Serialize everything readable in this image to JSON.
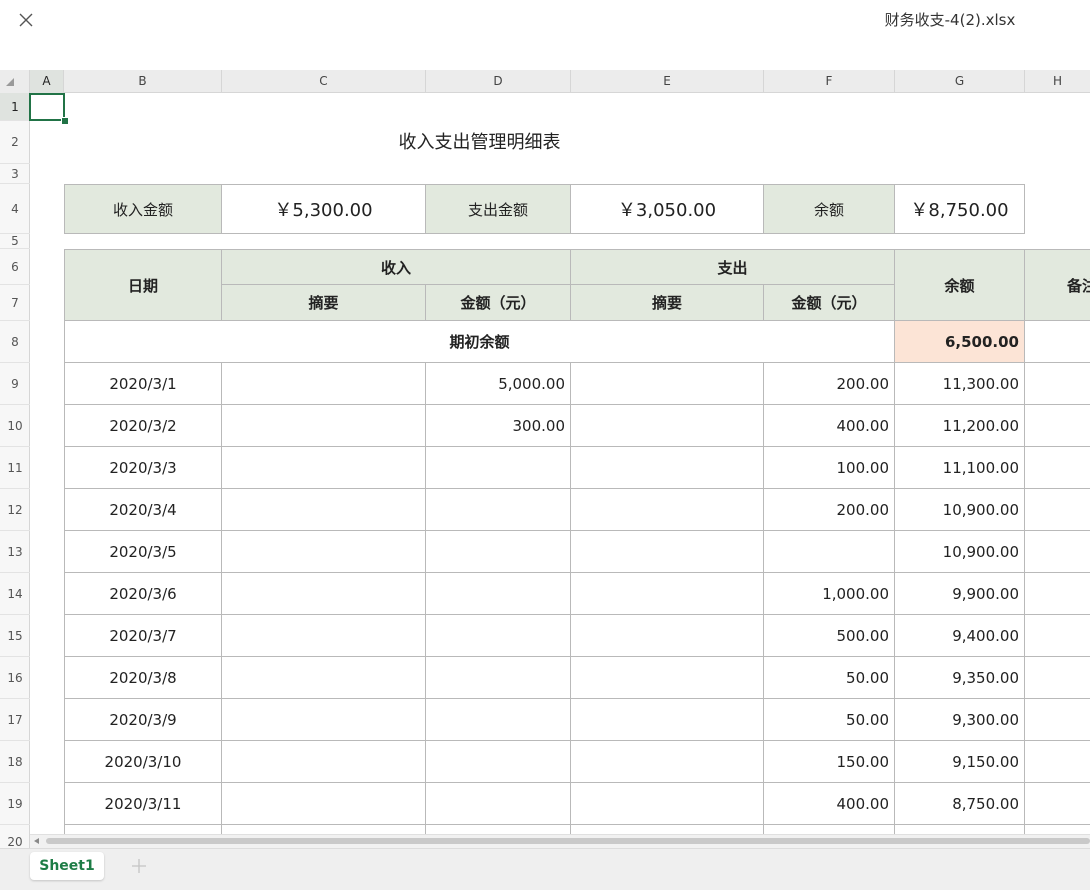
{
  "window": {
    "filename": "财务收支-4(2).xlsx"
  },
  "grid": {
    "columns": [
      "A",
      "B",
      "C",
      "D",
      "E",
      "F",
      "G",
      "H"
    ],
    "rows": [
      "1",
      "2",
      "3",
      "4",
      "5",
      "6",
      "7",
      "8",
      "9",
      "10",
      "11",
      "12",
      "13",
      "14",
      "15",
      "16",
      "17",
      "18",
      "19",
      "20"
    ],
    "selected_cell": "A1",
    "accent_color": "#217346"
  },
  "sheet": {
    "title": "收入支出管理明细表",
    "summary": {
      "income_label": "收入金额",
      "income_value": "￥5,300.00",
      "expense_label": "支出金额",
      "expense_value": "￥3,050.00",
      "balance_label": "余额",
      "balance_value": "￥8,750.00"
    },
    "headers": {
      "date": "日期",
      "income": "收入",
      "expense": "支出",
      "summary": "摘要",
      "amount": "金额（元）",
      "balance": "余额",
      "notes": "备注"
    },
    "opening": {
      "label": "期初余额",
      "value": "6,500.00"
    },
    "records": [
      {
        "date": "2020/3/1",
        "income_amount": "5,000.00",
        "expense_amount": "200.00",
        "balance": "11,300.00"
      },
      {
        "date": "2020/3/2",
        "income_amount": "300.00",
        "expense_amount": "400.00",
        "balance": "11,200.00"
      },
      {
        "date": "2020/3/3",
        "income_amount": "",
        "expense_amount": "100.00",
        "balance": "11,100.00"
      },
      {
        "date": "2020/3/4",
        "income_amount": "",
        "expense_amount": "200.00",
        "balance": "10,900.00"
      },
      {
        "date": "2020/3/5",
        "income_amount": "",
        "expense_amount": "",
        "balance": "10,900.00"
      },
      {
        "date": "2020/3/6",
        "income_amount": "",
        "expense_amount": "1,000.00",
        "balance": "9,900.00"
      },
      {
        "date": "2020/3/7",
        "income_amount": "",
        "expense_amount": "500.00",
        "balance": "9,400.00"
      },
      {
        "date": "2020/3/8",
        "income_amount": "",
        "expense_amount": "50.00",
        "balance": "9,350.00"
      },
      {
        "date": "2020/3/9",
        "income_amount": "",
        "expense_amount": "50.00",
        "balance": "9,300.00"
      },
      {
        "date": "2020/3/10",
        "income_amount": "",
        "expense_amount": "150.00",
        "balance": "9,150.00"
      },
      {
        "date": "2020/3/11",
        "income_amount": "",
        "expense_amount": "400.00",
        "balance": "8,750.00"
      }
    ]
  },
  "tabs": {
    "active": "Sheet1",
    "add_icon": "plus-icon"
  },
  "colors": {
    "header_fill": "#e2e9de",
    "opening_fill": "#fce4d6",
    "tab_text": "#1e7d46"
  }
}
